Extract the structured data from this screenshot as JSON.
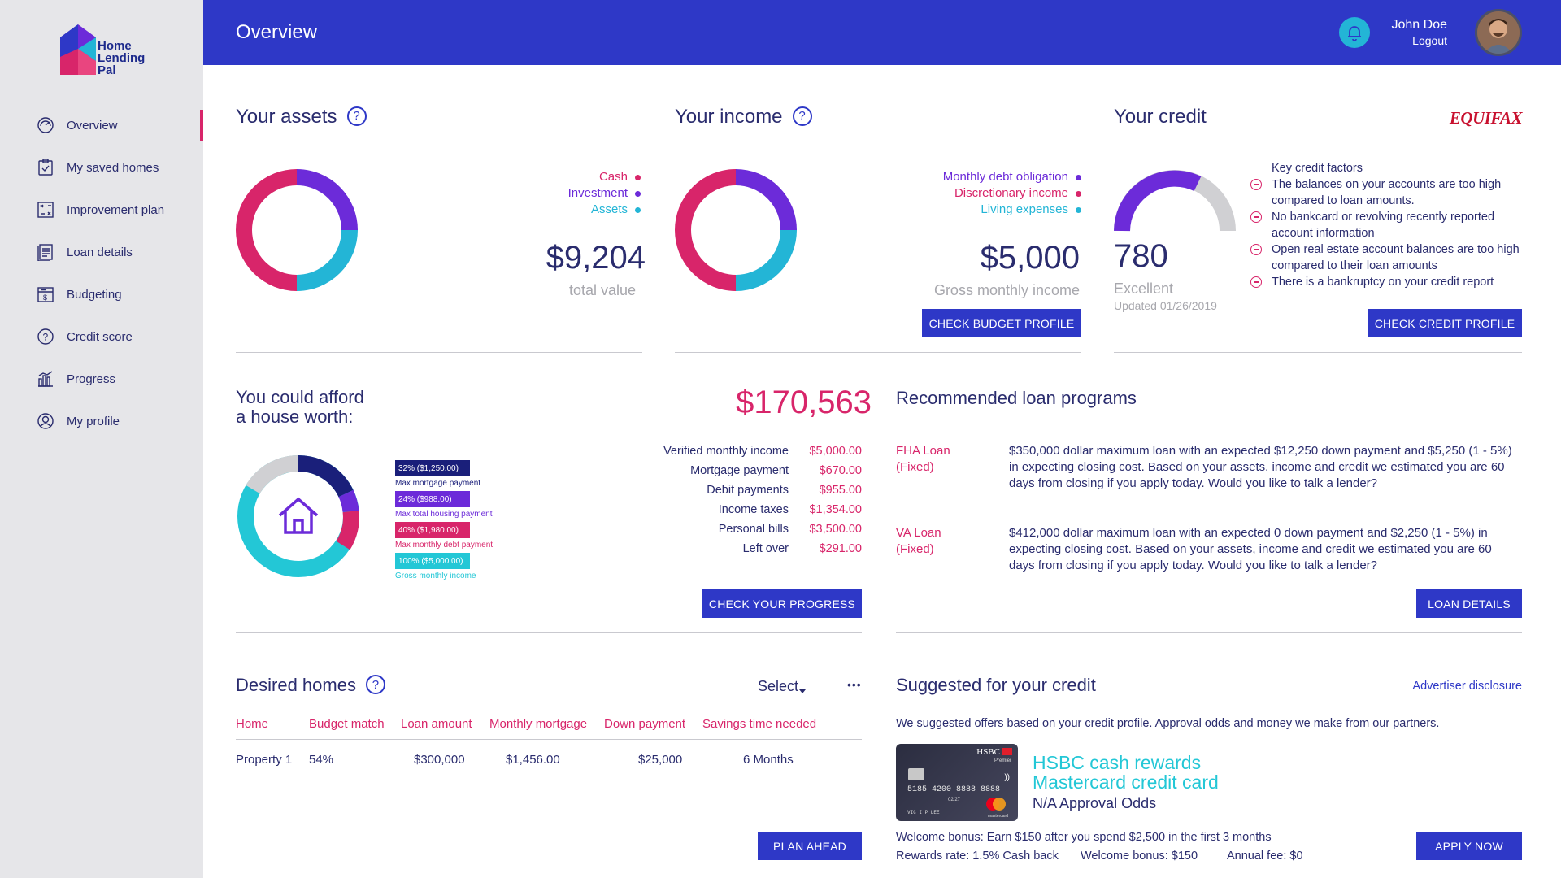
{
  "brand": {
    "name_line1": "Home",
    "name_line2": "Lending",
    "name_line3": "Pal"
  },
  "sidebar": {
    "items": [
      {
        "label": "Overview",
        "icon": "dashboard-icon"
      },
      {
        "label": "My saved homes",
        "icon": "clipboard-icon"
      },
      {
        "label": "Improvement plan",
        "icon": "plan-icon"
      },
      {
        "label": "Loan details",
        "icon": "document-icon"
      },
      {
        "label": "Budgeting",
        "icon": "budget-icon"
      },
      {
        "label": "Credit score",
        "icon": "question-icon"
      },
      {
        "label": "Progress",
        "icon": "bar-chart-icon"
      },
      {
        "label": "My profile",
        "icon": "profile-icon"
      }
    ]
  },
  "header": {
    "title": "Overview",
    "user_name": "John Doe",
    "logout": "Logout"
  },
  "assets": {
    "title": "Your assets",
    "help": "?",
    "legend": [
      {
        "label": "Cash",
        "color": "#d8256a"
      },
      {
        "label": "Investment",
        "color": "#6c2bd9"
      },
      {
        "label": "Assets",
        "color": "#23b5d6"
      }
    ],
    "value": "$9,204",
    "caption": "total value"
  },
  "income": {
    "title": "Your income",
    "help": "?",
    "legend": [
      {
        "label": "Monthly debt obligation",
        "color": "#6c2bd9"
      },
      {
        "label": "Discretionary income",
        "color": "#d8256a"
      },
      {
        "label": "Living expenses",
        "color": "#23b5d6"
      }
    ],
    "value": "$5,000",
    "caption": "Gross monthly income",
    "button": "CHECK BUDGET PROFILE"
  },
  "credit": {
    "title": "Your credit",
    "bureau": "EQUIFAX",
    "score": "780",
    "rating": "Excellent",
    "updated": "Updated 01/26/2019",
    "factors_title": "Key credit factors",
    "factors": [
      "The balances on your accounts are too high compared to loan amounts.",
      "No bankcard or revolving recently reported account information",
      "Open real estate account balances are too high compared to their loan amounts",
      "There is a bankruptcy on your credit report"
    ],
    "button": "CHECK CREDIT PROFILE"
  },
  "afford": {
    "title_line1": "You could afford",
    "title_line2": "a house worth:",
    "amount": "$170,563",
    "bars": [
      {
        "label": "32% ($1,250.00)",
        "caption": "Max mortgage payment",
        "color": "#1a1f7a"
      },
      {
        "label": "24% ($988.00)",
        "caption": "Max total housing payment",
        "color": "#6c2bd9"
      },
      {
        "label": "40% ($1,980.00)",
        "caption": "Max monthly debt payment",
        "color": "#d8256a"
      },
      {
        "label": "100% ($5,000.00)",
        "caption": "Gross monthly income",
        "color": "#23c7d6"
      }
    ],
    "breakdown": [
      {
        "label": "Verified monthly income",
        "value": "$5,000.00"
      },
      {
        "label": "Mortgage payment",
        "value": "$670.00"
      },
      {
        "label": "Debit payments",
        "value": "$955.00"
      },
      {
        "label": "Income taxes",
        "value": "$1,354.00"
      },
      {
        "label": "Personal bills",
        "value": "$3,500.00"
      },
      {
        "label": "Left over",
        "value": "$291.00"
      }
    ],
    "button": "CHECK YOUR PROGRESS"
  },
  "loans": {
    "title": "Recommended loan programs",
    "programs": [
      {
        "name_line1": "FHA Loan",
        "name_line2": "(Fixed)",
        "desc": "$350,000 dollar maximum loan with an expected $12,250 down payment and $5,250 (1 - 5%) in expecting closing cost. Based on your assets, income and credit we estimated you are 60 days from closing if you apply today. Would you like to talk a lender?"
      },
      {
        "name_line1": "VA Loan",
        "name_line2": "(Fixed)",
        "desc": "$412,000 dollar maximum loan with an expected 0 down payment and $2,250 (1 - 5%) in expecting closing cost. Based on your assets, income and credit we estimated you are 60 days from closing if you apply today. Would you like to talk a lender?"
      }
    ],
    "button": "LOAN DETAILS"
  },
  "homes": {
    "title": "Desired homes",
    "help": "?",
    "select": "Select",
    "more": "•••",
    "columns": [
      "Home",
      "Budget match",
      "Loan amount",
      "Monthly mortgage",
      "Down payment",
      "Savings time needed"
    ],
    "rows": [
      [
        "Property 1",
        "54%",
        "$300,000",
        "$1,456.00",
        "$25,000",
        "6 Months"
      ]
    ],
    "button": "PLAN AHEAD"
  },
  "suggested": {
    "title": "Suggested for your credit",
    "disclosure": "Advertiser disclosure",
    "intro": "We suggested offers based on your credit profile. Approval odds and money we make from our partners.",
    "card_bank": "HSBC",
    "card_tier": "Premier",
    "card_number": "5185 4200 8888 8888",
    "card_expiry": "02/27",
    "card_holder": "VIC I P LEE",
    "card_network": "mastercard",
    "offer_line1": "HSBC cash rewards",
    "offer_line2": "Mastercard credit card",
    "odds": "N/A Approval Odds",
    "welcome": "Welcome bonus: Earn $150 after you spend $2,500 in the first 3 months",
    "rewards_rate": "Rewards rate: 1.5% Cash back",
    "welcome_bonus": "Welcome bonus: $150",
    "annual_fee": "Annual fee: $0",
    "button": "APPLY NOW"
  }
}
